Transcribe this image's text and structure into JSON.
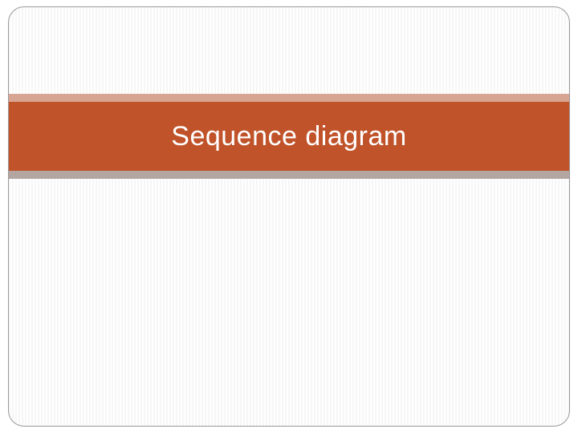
{
  "slide": {
    "title": "Sequence diagram"
  }
}
